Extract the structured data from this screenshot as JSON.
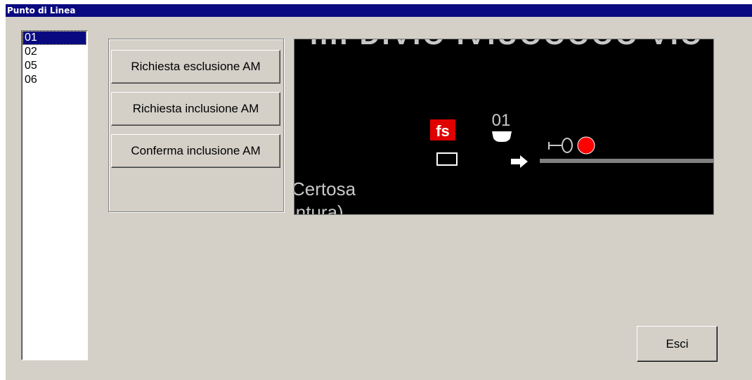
{
  "window": {
    "title": "Punto di Linea"
  },
  "list": {
    "items": [
      {
        "label": "01",
        "selected": true
      },
      {
        "label": "02",
        "selected": false
      },
      {
        "label": "05",
        "selected": false
      },
      {
        "label": "06",
        "selected": false
      }
    ]
  },
  "buttons": {
    "richiesta_esclusione": "Richiesta esclusione AM",
    "richiesta_inclusione": "Richiesta inclusione AM",
    "conferma_inclusione": "Conferma inclusione AM",
    "esci": "Esci"
  },
  "display": {
    "top_text_partial": "IIII DIVIO IVIUOOOOO VIC",
    "fs_logo": "fs",
    "point_number": "01",
    "station_line1": "Certosa",
    "station_line2": "intura)",
    "colors": {
      "background": "#000000",
      "text": "#c8c8c8",
      "fs_red": "#e00000",
      "signal_red": "#ff0000",
      "track": "#808080",
      "white": "#ffffff"
    }
  }
}
